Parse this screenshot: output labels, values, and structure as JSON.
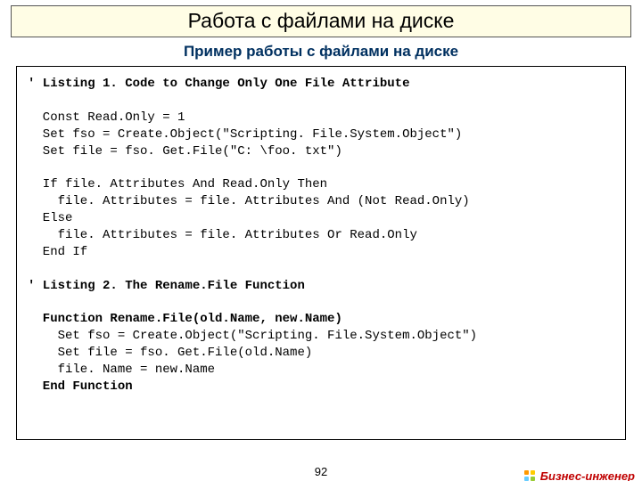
{
  "title": "Работа с файлами на диске",
  "subtitle": "Пример работы с файлами на диске",
  "listing1": {
    "header": "' Listing 1. Code to Change Only One File Attribute",
    "lines": [
      "  Const Read.Only = 1",
      "  Set fso = Create.Object(\"Scripting. File.System.Object\")",
      "  Set file = fso. Get.File(\"C: \\foo. txt\")",
      "",
      "  If file. Attributes And Read.Only Then",
      "    file. Attributes = file. Attributes And (Not Read.Only)",
      "  Else",
      "    file. Attributes = file. Attributes Or Read.Only",
      "  End If"
    ]
  },
  "listing2": {
    "header": "' Listing 2. The Rename.File Function",
    "lines_bold": [
      "  Function Rename.File(old.Name, new.Name)"
    ],
    "lines_plain": [
      "    Set fso = Create.Object(\"Scripting. File.System.Object\")",
      "    Set file = fso. Get.File(old.Name)",
      "    file. Name = new.Name"
    ],
    "lines_bold_end": [
      "  End Function"
    ]
  },
  "pageNumber": "92",
  "brand": "Бизнес-инженер"
}
